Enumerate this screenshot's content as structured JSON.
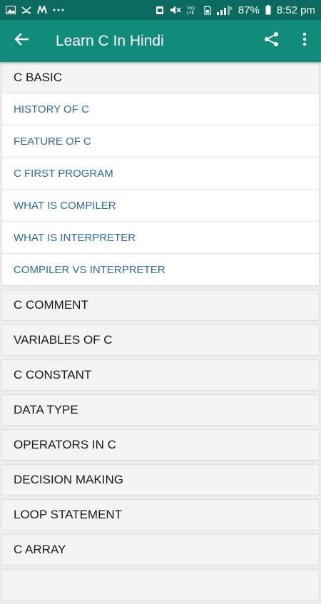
{
  "statusbar": {
    "left_icons": [
      "gallery-icon",
      "missed-call-icon",
      "m-icon",
      "more-dots-icon"
    ],
    "right_icons": [
      "alarm-icon",
      "mute-icon",
      "volte-icon",
      "sim-icon",
      "signal-icon",
      "battery-icon"
    ],
    "volte_label": "Vo))\nLTE",
    "battery_percent": "87%",
    "time": "8:52 pm"
  },
  "appbar": {
    "title": "Learn C In Hindi",
    "back_icon": "back-arrow-icon",
    "share_icon": "share-icon",
    "overflow_icon": "overflow-menu-icon"
  },
  "colors": {
    "statusbar": "#0b6b60",
    "appbar": "#118c7c",
    "child_text": "#2e6c9a",
    "header_text": "#1a1a1a"
  },
  "groups": [
    {
      "label": "C BASIC",
      "expanded": true,
      "children": [
        "HISTORY OF C",
        "FEATURE OF C",
        "C FIRST PROGRAM",
        "WHAT IS COMPILER",
        "WHAT IS INTERPRETER",
        "COMPILER VS INTERPRETER"
      ]
    },
    {
      "label": "C COMMENT"
    },
    {
      "label": "VARIABLES OF C"
    },
    {
      "label": "C CONSTANT"
    },
    {
      "label": "DATA TYPE"
    },
    {
      "label": "OPERATORS IN C"
    },
    {
      "label": "DECISION MAKING"
    },
    {
      "label": "LOOP STATEMENT"
    },
    {
      "label": "C ARRAY"
    },
    {
      "label": ""
    }
  ]
}
